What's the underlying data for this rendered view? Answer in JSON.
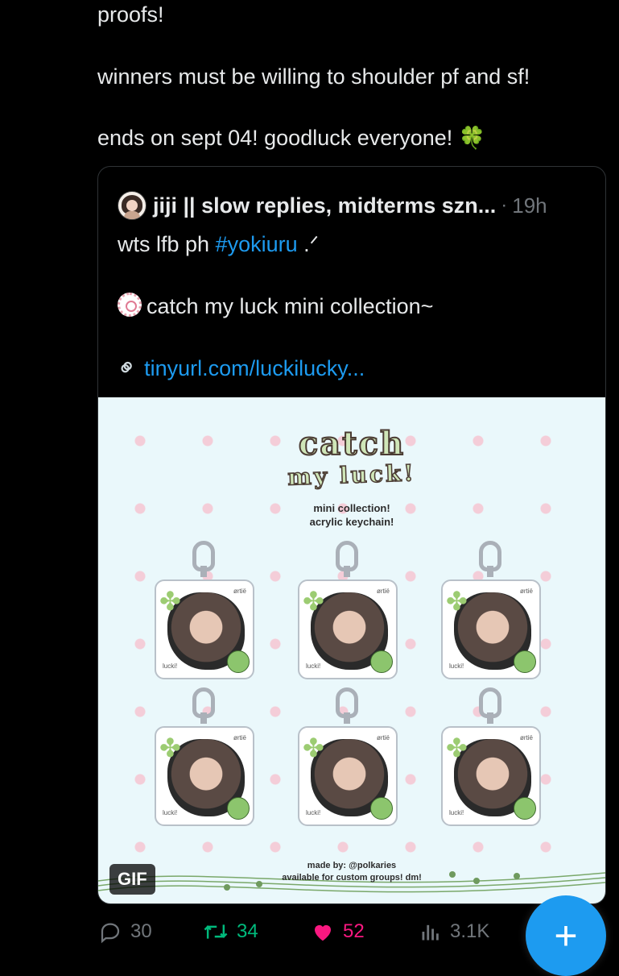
{
  "tweet": {
    "lines": [
      "proofs!",
      "winners must be willing to shoulder pf and sf!",
      "ends on sept 04! goodluck everyone! 🍀"
    ]
  },
  "quote": {
    "author": "jiji || slow replies, midterms szn...",
    "separator": "·",
    "time": "19h",
    "text_prefix": "wts lfb ph ",
    "hashtag": "#yokiuru",
    "text_suffix": " .ᐟ",
    "collection": "catch my luck mini collection~",
    "link": "tinyurl.com/luckilucky..."
  },
  "media": {
    "title_line1": "catch",
    "title_line2": "my luck!",
    "subtitle_line1": "mini collection!",
    "subtitle_line2": "acrylic keychain!",
    "keychain_tag_top": "ørtië",
    "keychain_tag_bottom": "lucki!",
    "made_by": "made by: @polkaries",
    "custom": "available for custom groups! dm!",
    "badge": "GIF"
  },
  "actions": {
    "replies": "30",
    "retweets": "34",
    "likes": "52",
    "views": "3.1K"
  },
  "fab": {
    "label": "+"
  },
  "colors": {
    "accent": "#1d9bf0",
    "retweet": "#00ba7c",
    "like": "#f91880",
    "muted": "#71767b"
  }
}
